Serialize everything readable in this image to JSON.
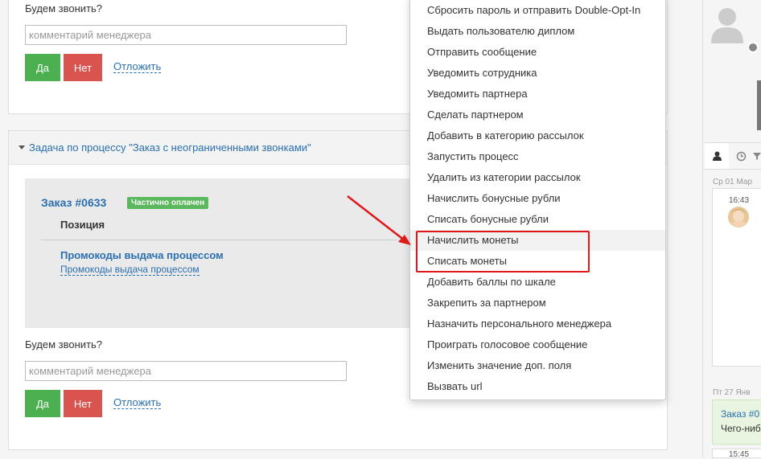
{
  "top_section": {
    "question": "Будем звонить?",
    "comment_placeholder": "комментарий менеджера",
    "yes_label": "Да",
    "no_label": "Нет",
    "postpone_label": "Отложить"
  },
  "task": {
    "title": "Задача по процессу \"Заказ с неограниченными звонками\"",
    "order": {
      "title": "Заказ #0633",
      "status_badge": "Частично оплачен",
      "column_header": "Позиция",
      "product_name": "Промокоды выдача процессом",
      "product_link": "Промокоды выдача процессом"
    },
    "question": "Будем звонить?",
    "comment_placeholder": "комментарий менеджера",
    "yes_label": "Да",
    "no_label": "Нет",
    "postpone_label": "Отложить"
  },
  "menu": {
    "items": [
      "Сбросить пароль и отправить Double-Opt-In",
      "Выдать пользователю диплом",
      "Отправить сообщение",
      "Уведомить сотрудника",
      "Уведомить партнера",
      "Сделать партнером",
      "Добавить в категорию рассылок",
      "Запустить процесс",
      "Удалить из категории рассылок",
      "Начислить бонусные рубли",
      "Списать бонусные рубли",
      "Начислить монеты",
      "Списать монеты",
      "Добавить баллы по шкале",
      "Закрепить за партнером",
      "Назначить персонального менеджера",
      "Проиграть голосовое сообщение",
      "Изменить значение доп. поля",
      "Вызвать url"
    ]
  },
  "sidebar": {
    "date_1": "Ср 01 Мар",
    "time_1": "16:43",
    "date_2": "Пт 27 Янв",
    "order_text": "Заказ #0",
    "message_text": "Чего-ниб",
    "time_2": "15:45",
    "tabs": [
      "user-icon",
      "history-icon",
      "filter-icon"
    ]
  },
  "colors": {
    "link": "#2a6fb0",
    "yes_button": "#4caf50",
    "no_button": "#d9534f",
    "badge": "#5cb85c",
    "annotation_red": "#e0181b"
  }
}
